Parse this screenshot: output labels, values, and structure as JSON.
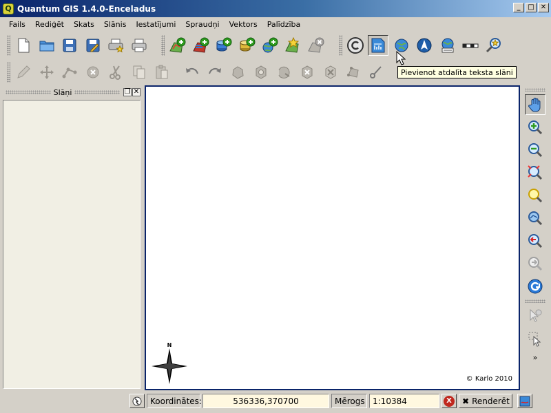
{
  "window": {
    "title": "Quantum GIS 1.4.0-Enceladus",
    "app_icon_letter": "Q",
    "minimize_label": "_",
    "maximize_label": "□",
    "close_label": "✕"
  },
  "menu": [
    "Fails",
    "Rediģēt",
    "Skats",
    "Slānis",
    "Iestatījumi",
    "Spraudņi",
    "Vektors",
    "Palīdzība"
  ],
  "tooltip": "Pievienot atdalīta teksta slāni",
  "layers_panel": {
    "title": "Slāņi",
    "float_glyph": "❐",
    "close_glyph": "✕"
  },
  "canvas": {
    "copyright": "© Karlo 2010",
    "north_label": "N"
  },
  "navbar": {
    "more_glyph": "»"
  },
  "status": {
    "coord_label": "Koordinātes:",
    "coord_value": "536336,370700",
    "scale_label": "Mērogs",
    "scale_value": "1:10384",
    "stop_glyph": "X",
    "render_label": "Renderēt",
    "render_glyph": "✖"
  },
  "colors": {
    "title_gradient_start": "#0a246a",
    "canvas_border": "#0a246a",
    "panel_bg": "#f1efe4",
    "chrome_bg": "#d4d0c8",
    "green_plus": "#2e9a1e"
  }
}
